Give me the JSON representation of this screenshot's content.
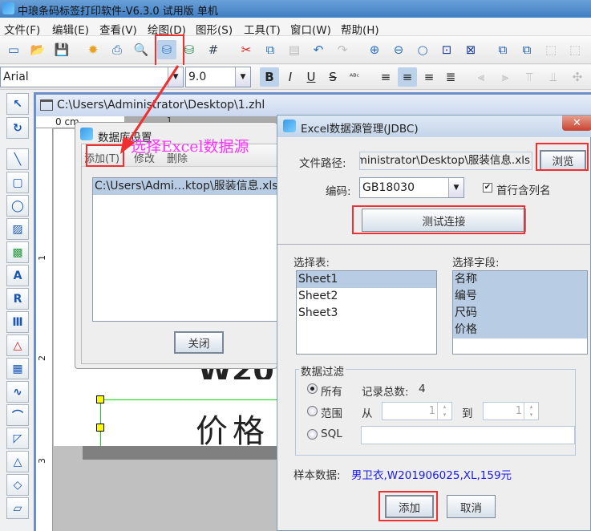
{
  "app": {
    "title": "中琅条码标签打印软件-V6.3.0 试用版 单机"
  },
  "menu": [
    "文件(F)",
    "编辑(E)",
    "查看(V)",
    "绘图(D)",
    "图形(S)",
    "工具(T)",
    "窗口(W)",
    "帮助(H)"
  ],
  "format_bar": {
    "font": "Arial",
    "size": "9.0",
    "bold": "B",
    "italic": "I",
    "underline": "U",
    "strike": "S"
  },
  "document": {
    "title": "C:\\Users\\Administrator\\Desktop\\1.zhl",
    "ruler_unit": "0 cm",
    "ruler_h": [
      "1"
    ],
    "ruler_v": [
      "1",
      "2",
      "3"
    ],
    "canvas_text_1": "W20",
    "canvas_text_2": "价格"
  },
  "db_dialog": {
    "title": "数据库设置",
    "menu": {
      "add": "添加(T)",
      "edit": "修改",
      "delete": "删除"
    },
    "items": [
      "C:\\Users\\Admi…ktop\\服装信息.xls"
    ],
    "close": "关闭"
  },
  "annotation": "选择Excel数据源",
  "excel_dialog": {
    "title": "Excel数据源管理(JDBC)",
    "file_path_label": "文件路径:",
    "file_path": "Administrator\\Desktop\\服装信息.xls",
    "browse": "浏览",
    "encoding_label": "编码:",
    "encoding": "GB18030",
    "header_row_label": "首行含列名",
    "header_row_checked": true,
    "test_connection": "测试连接",
    "tables_label": "选择表:",
    "tables": [
      "Sheet1",
      "Sheet2",
      "Sheet3"
    ],
    "selected_table": "Sheet1",
    "fields_label": "选择字段:",
    "fields": [
      "名称",
      "编号",
      "尺码",
      "价格"
    ],
    "filter": {
      "legend": "数据过滤",
      "all": "所有",
      "range": "范围",
      "sql": "SQL",
      "total_label": "记录总数:",
      "total": "4",
      "from": "从",
      "to": "到",
      "from_value": "1",
      "to_value": "1",
      "selected": "所有"
    },
    "sample_label": "样本数据:",
    "sample": "男卫衣,W201906025,XL,159元",
    "add": "添加",
    "cancel": "取消"
  },
  "colors": {
    "highlight": "#f03030",
    "annotation": "#ff33ff",
    "sample": "#1a1aee",
    "selection": "#b8cce4"
  }
}
